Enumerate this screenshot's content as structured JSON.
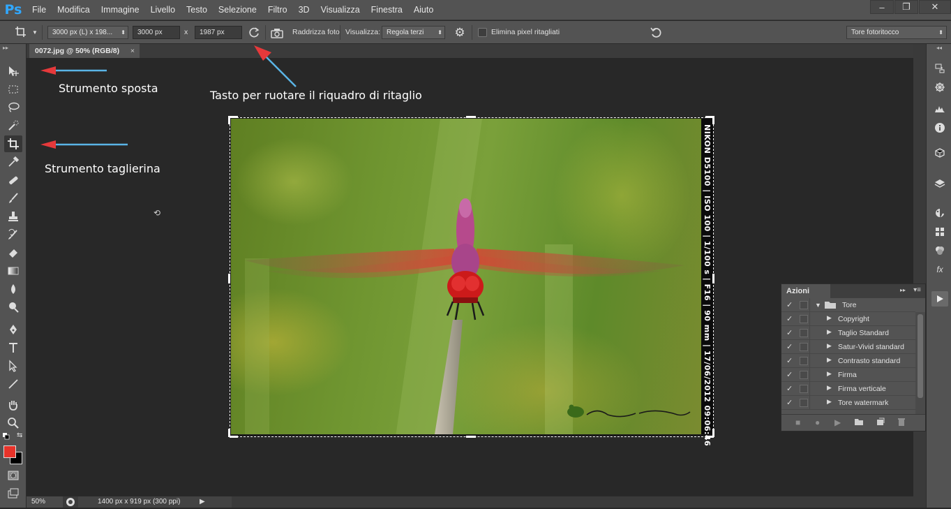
{
  "app": {
    "logo": "Ps"
  },
  "menu": [
    "File",
    "Modifica",
    "Immagine",
    "Livello",
    "Testo",
    "Selezione",
    "Filtro",
    "3D",
    "Visualizza",
    "Finestra",
    "Aiuto"
  ],
  "window_controls": {
    "minimize": "‒",
    "restore": "❐",
    "close": "✕"
  },
  "options": {
    "ratio_preset": "3000 px (L) x 198...",
    "width": "3000 px",
    "x_label": "x",
    "height": "1987 px",
    "straighten_label": "Raddrizza foto",
    "view_label": "Visualizza:",
    "overlay": "Regola terzi",
    "delete_pixels_label": "Elimina pixel ritagliati",
    "workspace": "Tore fotoritocco"
  },
  "document": {
    "tab_title": "0072.jpg @ 50% (RGB/8)",
    "tab_close": "×",
    "exif_caption": "NIKON D5100 | ISO 100 | 1/100 s | F16 | 90 mm | 17/06/2012 09:06:46"
  },
  "annotations": {
    "move_tool": "Strumento sposta",
    "crop_tool": "Strumento taglierina",
    "rotate_key": "Tasto per ruotare il riquadro di ritaglio"
  },
  "actions_panel": {
    "title": "Azioni",
    "set_name": "Tore",
    "items": [
      "Copyright",
      "Taglio Standard",
      "Satur-Vivid standard",
      "Contrasto standard",
      "Firma",
      "Firma verticale",
      "Tore watermark"
    ]
  },
  "status": {
    "zoom": "50%",
    "doc_size": "1400 px x 919 px (300 ppi)"
  },
  "colors": {
    "foreground": "#e8332a",
    "background": "#000000",
    "ui_panel": "#535353",
    "canvas_bg": "#282828",
    "arrow_red": "#e5393b",
    "arrow_blue": "#5ab4e6"
  }
}
